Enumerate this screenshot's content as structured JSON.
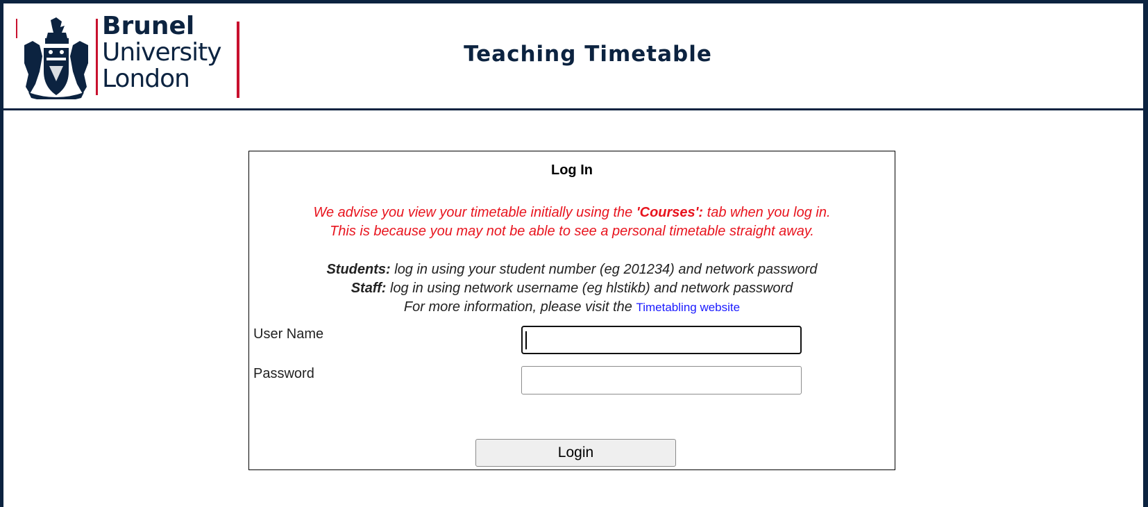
{
  "header": {
    "logo": {
      "line1": "Brunel",
      "line2": "University",
      "line3": "London"
    },
    "title": "Teaching Timetable"
  },
  "login": {
    "title": "Log In",
    "advice_line1_pre": "We advise you view your timetable initially using the ",
    "advice_line1_bold": "'Courses':",
    "advice_line1_post": " tab when you log in.",
    "advice_line2": "This is because you may not be able to see a personal timetable straight away.",
    "students_label": "Students:",
    "students_text": " log in using your student number (eg 201234) and network password",
    "staff_label": "Staff:",
    "staff_text": " log in using network username (eg hlstikb) and network password",
    "more_info_text": "For more information, please visit the ",
    "more_info_link": "Timetabling website",
    "username_label": "User Name",
    "username_value": "",
    "password_label": "Password",
    "password_value": "",
    "submit_label": "Login"
  },
  "colors": {
    "brand_navy": "#0c2340",
    "brand_red": "#c8102e",
    "advice_red": "#e8141e",
    "link_blue": "#1a1aff"
  }
}
